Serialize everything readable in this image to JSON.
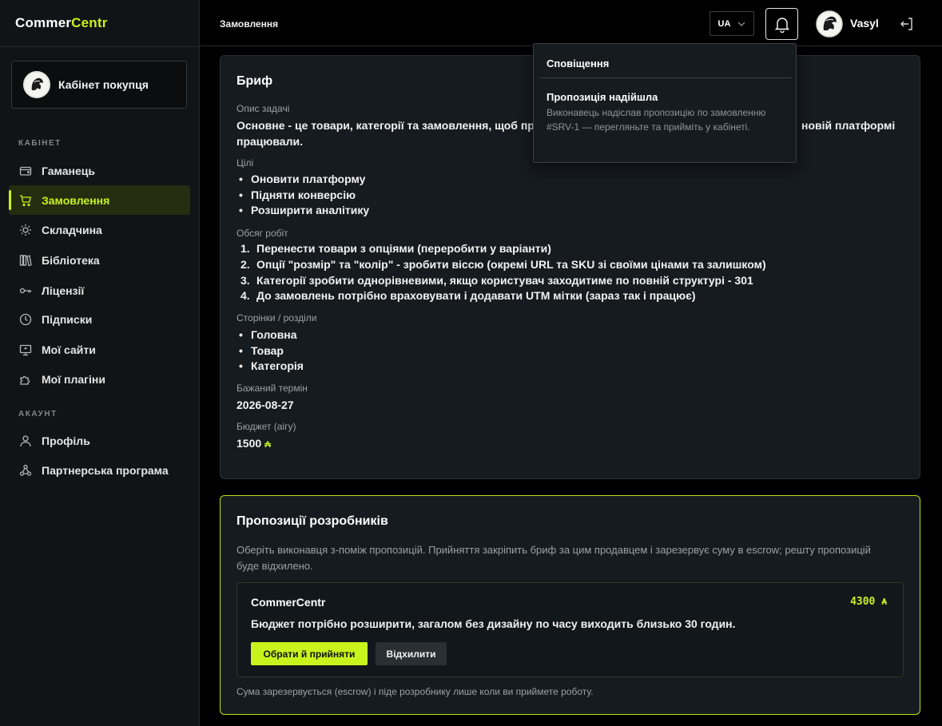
{
  "app": {
    "logo_main": "Commer",
    "logo_accent": "Centr"
  },
  "sidebar": {
    "cabinet_label": "Кабінет покупця",
    "section_cabinet": "КАБІНЕТ",
    "section_account": "АКАУНТ",
    "items": [
      {
        "label": "Гаманець",
        "icon": "wallet-icon"
      },
      {
        "label": "Замовлення",
        "icon": "cart-icon",
        "active": true
      },
      {
        "label": "Складчина",
        "icon": "sun-icon"
      },
      {
        "label": "Бібліотека",
        "icon": "library-icon"
      },
      {
        "label": "Ліцензії",
        "icon": "key-icon"
      },
      {
        "label": "Підписки",
        "icon": "clock-icon"
      },
      {
        "label": "Мої сайти",
        "icon": "monitor-icon"
      },
      {
        "label": "Мої плагіни",
        "icon": "puzzle-icon"
      }
    ],
    "account_items": [
      {
        "label": "Профіль",
        "icon": "user-icon"
      },
      {
        "label": "Партнерська програма",
        "icon": "network-icon"
      }
    ]
  },
  "header": {
    "page_title": "Замовлення",
    "lang": "UA",
    "user_name": "Vasyl"
  },
  "brief": {
    "title": "Бриф",
    "task_label": "Опис задачі",
    "task_line1": "Основне - це товари, категорії та замовлення, щоб прої",
    "task_line1_end": "новій платформі",
    "task_line2": "працювали.",
    "goals_label": "Цілі",
    "goals": [
      "Оновити платформу",
      "Підняти конверсію",
      "Розширити аналітику"
    ],
    "scope_label": "Обсяг робіт",
    "scope": [
      "Перенести товари з опціями (переробити у варіанти)",
      "Опції \"розмір\" та \"колір\" - зробити віссю (окремі URL та SKU зі своїми цінами та залишком)",
      "Категорії зробити однорівневими, якщо користувач заходитиме по повній структурі - 301",
      "До замовлень потрібно враховувати і додавати UTM мітки (зараз так і працює)"
    ],
    "pages_label": "Сторінки / розділи",
    "pages": [
      "Головна",
      "Товар",
      "Категорія"
    ],
    "deadline_label": "Бажаний термін",
    "deadline": "2026-08-27",
    "budget_label": "Бюджет (аігу)",
    "budget": "1500",
    "currency_symbol": "₳"
  },
  "proposals": {
    "title": "Пропозиції розробників",
    "intro": "Оберіть виконавця з-поміж пропозицій. Прийняття закріпить бриф за цим продавцем і зарезервує суму в escrow; решту пропозицій буде відхилено.",
    "offer": {
      "developer": "CommerCentr",
      "amount": "4300",
      "message": "Бюджет потрібно розширити, загалом без дизайну по часу виходить близько 30 годин.",
      "accept_label": "Обрати й прийняти",
      "reject_label": "Відхилити"
    },
    "note": "Сума зарезервується (escrow) і піде розробнику лише коли ви приймете роботу."
  },
  "notifications": {
    "title": "Сповіщення",
    "item_title": "Пропозиція надійшла",
    "item_body": "Виконавець надіслав пропозицію по замовленню #SRV-1 — перегляньте та прийміть у кабінеті."
  },
  "colors": {
    "accent": "#c8f31d",
    "bg": "#000000",
    "panel": "#161b20",
    "sidebar": "#111416"
  }
}
